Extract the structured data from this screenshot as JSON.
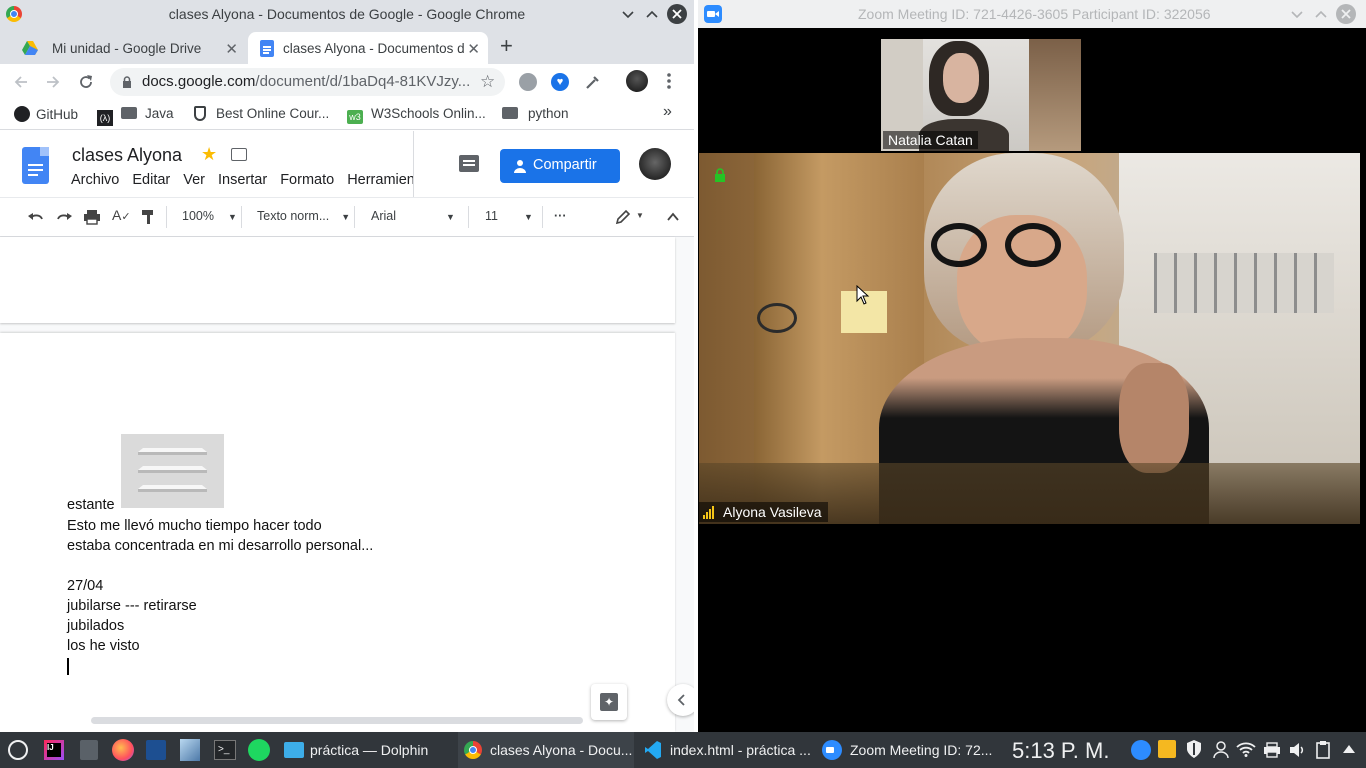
{
  "chrome": {
    "window_title": "clases Alyona - Documentos de Google - Google Chrome",
    "tabs": [
      {
        "label": "Mi unidad - Google Drive",
        "icon": "drive-icon"
      },
      {
        "label": "clases Alyona - Documentos d",
        "icon": "docs-icon",
        "active": true
      }
    ],
    "url_domain": "docs.google.com",
    "url_path": "/document/d/1baDq4-81KVJzy...",
    "bookmarks": [
      "GitHub",
      "Java",
      "Best Online Cour...",
      "W3Schools Onlin...",
      "python"
    ],
    "bookmarks_more": "»"
  },
  "docs": {
    "title": "clases Alyona",
    "menu": [
      "Archivo",
      "Editar",
      "Ver",
      "Insertar",
      "Formato",
      "Herramien"
    ],
    "share_label": "Compartir",
    "zoom": "100%",
    "style": "Texto norm...",
    "font": "Arial",
    "size": "11",
    "more": "···",
    "lines": [
      "estante",
      "Esto me llevó mucho tiempo hacer todo",
      "estaba concentrada en mi desarrollo personal...",
      "27/04",
      "jubilarse --- retirarse",
      "jubilados",
      "los he visto"
    ]
  },
  "zoom": {
    "title": "Zoom Meeting ID: 721-4426-3605 Participant ID: 322056",
    "thumb_name": "Natalia Catan",
    "main_name": "Alyona Vasileva"
  },
  "taskbar": {
    "dolphin": "práctica — Dolphin",
    "chrome": "clases Alyona - Docu...",
    "vscode": "index.html - práctica ...",
    "zoom": "Zoom Meeting ID: 72...",
    "clock": "5:13 P. M."
  },
  "colors": {
    "accent": "#1a73e8",
    "star": "#fbbc04",
    "taskbar": "#31363b"
  }
}
